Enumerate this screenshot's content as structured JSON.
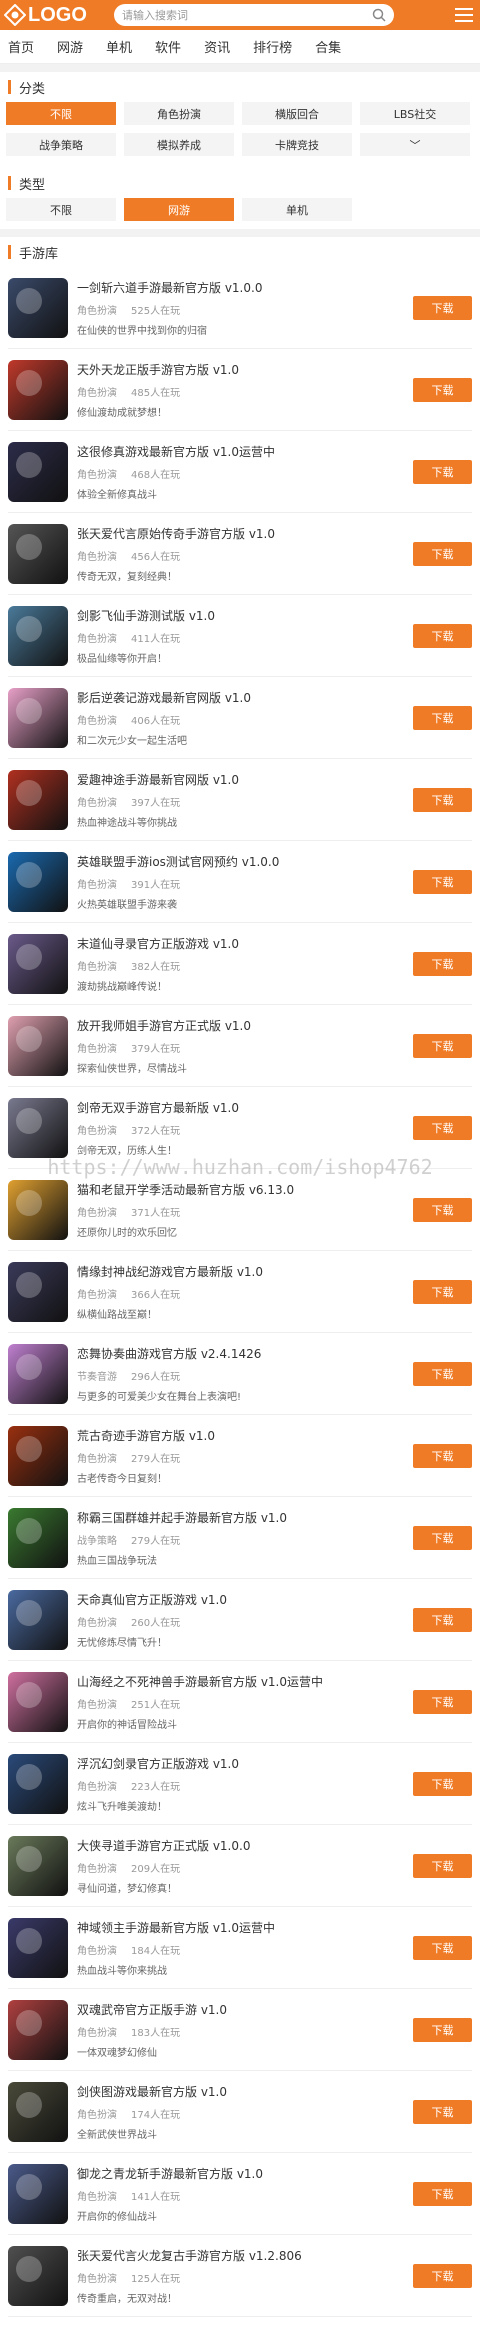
{
  "header": {
    "logo_text": "LOGO",
    "search_placeholder": "请输入搜索词"
  },
  "nav": [
    "首页",
    "网游",
    "单机",
    "软件",
    "资讯",
    "排行榜",
    "合集"
  ],
  "category": {
    "title": "分类",
    "tags": [
      {
        "label": "不限",
        "active": true
      },
      {
        "label": "角色扮演",
        "active": false
      },
      {
        "label": "横版回合",
        "active": false
      },
      {
        "label": "LBS社交",
        "active": false
      },
      {
        "label": "战争策略",
        "active": false
      },
      {
        "label": "模拟养成",
        "active": false
      },
      {
        "label": "卡牌竞技",
        "active": false
      },
      {
        "label": "﹀",
        "active": false
      }
    ]
  },
  "type": {
    "title": "类型",
    "tags": [
      {
        "label": "不限",
        "active": false
      },
      {
        "label": "网游",
        "active": true
      },
      {
        "label": "单机",
        "active": false
      }
    ]
  },
  "list_title": "手游库",
  "download_label": "下载",
  "games": [
    {
      "title": "一剑斩六道手游最新官方版 v1.0.0",
      "genre": "角色扮演",
      "players": "525人在玩",
      "desc": "在仙侠的世界中找到你的归宿",
      "color": "#3a4a6a"
    },
    {
      "title": "天外天龙正版手游官方版 v1.0",
      "genre": "角色扮演",
      "players": "485人在玩",
      "desc": "修仙渡劫成就梦想！",
      "color": "#c0392b"
    },
    {
      "title": "这很修真游戏最新官方版 v1.0运营中",
      "genre": "角色扮演",
      "players": "468人在玩",
      "desc": "体验全新修真战斗",
      "color": "#2c2c4a"
    },
    {
      "title": "张天爱代言原始传奇手游官方版 v1.0",
      "genre": "角色扮演",
      "players": "456人在玩",
      "desc": "传奇无双，复刻经典！",
      "color": "#555"
    },
    {
      "title": "剑影飞仙手游测试版 v1.0",
      "genre": "角色扮演",
      "players": "411人在玩",
      "desc": "极品仙缘等你开启！",
      "color": "#4a7a9a"
    },
    {
      "title": "影后逆袭记游戏最新官网版 v1.0",
      "genre": "角色扮演",
      "players": "406人在玩",
      "desc": "和二次元少女一起生活吧",
      "color": "#e8a0c8"
    },
    {
      "title": "爱趣神途手游最新官网版 v1.0",
      "genre": "角色扮演",
      "players": "397人在玩",
      "desc": "热血神途战斗等你挑战",
      "color": "#b03020"
    },
    {
      "title": "英雄联盟手游ios测试官网预约 v1.0.0",
      "genre": "角色扮演",
      "players": "391人在玩",
      "desc": "火热英雄联盟手游来袭",
      "color": "#1a6ab0"
    },
    {
      "title": "末道仙寻录官方正版游戏 v1.0",
      "genre": "角色扮演",
      "players": "382人在玩",
      "desc": "渡劫挑战巅峰传说！",
      "color": "#6a5a8a"
    },
    {
      "title": "放开我师姐手游官方正式版 v1.0",
      "genre": "角色扮演",
      "players": "379人在玩",
      "desc": "探索仙侠世界，尽情战斗",
      "color": "#e0a0b0"
    },
    {
      "title": "剑帝无双手游官方最新版 v1.0",
      "genre": "角色扮演",
      "players": "372人在玩",
      "desc": "剑帝无双，历练人生！",
      "color": "#7a7a90"
    },
    {
      "title": "猫和老鼠开学季活动最新官方版 v6.13.0",
      "genre": "角色扮演",
      "players": "371人在玩",
      "desc": "还原你儿时的欢乐回忆",
      "color": "#e0a030"
    },
    {
      "title": "情缘封神战纪游戏官方最新版 v1.0",
      "genre": "角色扮演",
      "players": "366人在玩",
      "desc": "纵横仙路战至巅！",
      "color": "#3a3a5a"
    },
    {
      "title": "恋舞协奏曲游戏官方版 v2.4.1426",
      "genre": "节奏音游",
      "players": "296人在玩",
      "desc": "与更多的可爱美少女在舞台上表演吧!",
      "color": "#c080d0"
    },
    {
      "title": "荒古奇迹手游官方版 v1.0",
      "genre": "角色扮演",
      "players": "279人在玩",
      "desc": "古老传奇今日复刻！",
      "color": "#9a3010"
    },
    {
      "title": "称霸三国群雄并起手游最新官方版 v1.0",
      "genre": "战争策略",
      "players": "279人在玩",
      "desc": "热血三国战争玩法",
      "color": "#3a7a30"
    },
    {
      "title": "天命真仙官方正版游戏 v1.0",
      "genre": "角色扮演",
      "players": "260人在玩",
      "desc": "无忧修炼尽情飞升！",
      "color": "#4a6aa0"
    },
    {
      "title": "山海经之不死神兽手游最新官方版 v1.0运营中",
      "genre": "角色扮演",
      "players": "251人在玩",
      "desc": "开启你的神话冒险战斗",
      "color": "#d070a0"
    },
    {
      "title": "浮沉幻剑录官方正版游戏 v1.0",
      "genre": "角色扮演",
      "players": "223人在玩",
      "desc": "炫斗飞升唯美渡劫！",
      "color": "#2a4a7a"
    },
    {
      "title": "大侠寻道手游官方正式版 v1.0.0",
      "genre": "角色扮演",
      "players": "209人在玩",
      "desc": "寻仙问道，梦幻修真！",
      "color": "#6a7a5a"
    },
    {
      "title": "神域领主手游最新官方版 v1.0运营中",
      "genre": "角色扮演",
      "players": "184人在玩",
      "desc": "热血战斗等你来挑战",
      "color": "#3a3a6a"
    },
    {
      "title": "双魂武帝官方正版手游 v1.0",
      "genre": "角色扮演",
      "players": "183人在玩",
      "desc": "一体双魂梦幻修仙",
      "color": "#b04040"
    },
    {
      "title": "剑侠图游戏最新官方版 v1.0",
      "genre": "角色扮演",
      "players": "174人在玩",
      "desc": "全新武侠世界战斗",
      "color": "#4a4a3a"
    },
    {
      "title": "御龙之青龙斩手游最新官方版 v1.0",
      "genre": "角色扮演",
      "players": "141人在玩",
      "desc": "开启你的修仙战斗",
      "color": "#4a5a8a"
    },
    {
      "title": "张天爱代言火龙复古手游官方版 v1.2.806",
      "genre": "角色扮演",
      "players": "125人在玩",
      "desc": "传奇重启，无双对战！",
      "color": "#505050"
    }
  ],
  "watermark": "https://www.huzhan.com/ishop4762"
}
